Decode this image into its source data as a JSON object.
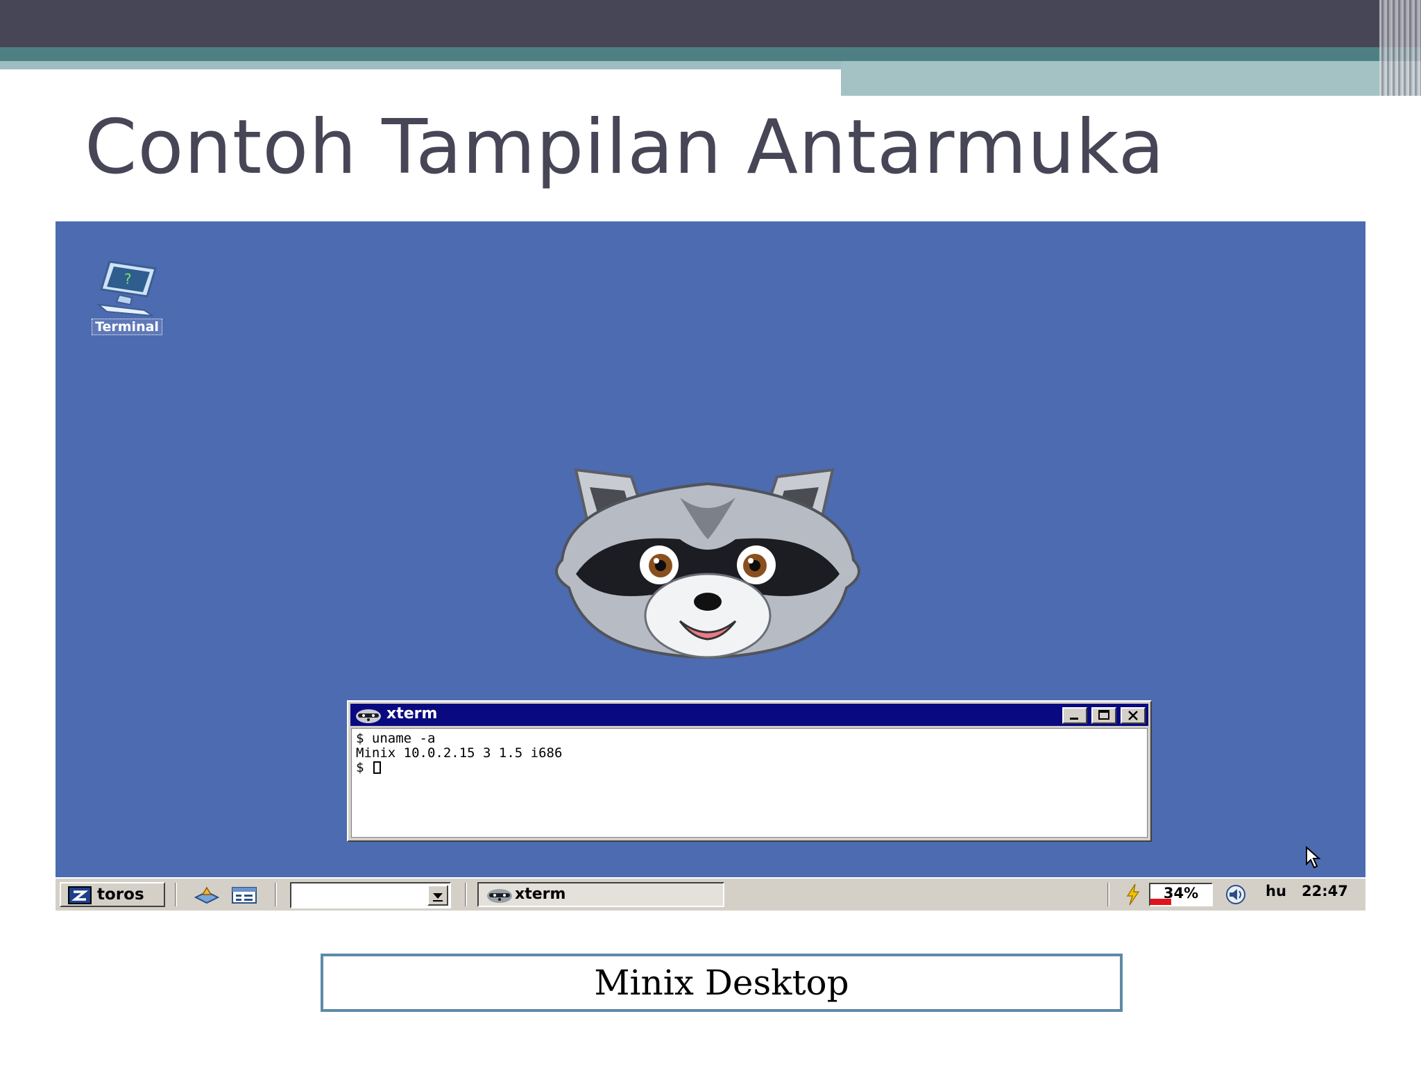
{
  "slide": {
    "title": "Contoh Tampilan Antarmuka",
    "caption": "Minix Desktop",
    "colors": {
      "header_dark": "#474656",
      "header_teal": "#4e8083",
      "caption_border": "#5d8aa8"
    }
  },
  "desktop": {
    "background_color": "#4d6bb1",
    "icons": [
      {
        "label": "Terminal",
        "icon": "terminal-monitor-icon"
      }
    ],
    "wallpaper": "raccoon-mascot-icon"
  },
  "xterm": {
    "title": "xterm",
    "icon": "raccoon-icon",
    "titlebar_color": "#0a0a80",
    "lines": [
      "$ uname -a",
      "Minix 10.0.2.15 3 1.5 i686",
      "$ "
    ]
  },
  "taskbar": {
    "start_label": "toros",
    "combo_value": "",
    "task_label": "xterm",
    "battery_text": "34%",
    "battery_level": 0.34,
    "language": "hu",
    "clock": "22:47"
  }
}
